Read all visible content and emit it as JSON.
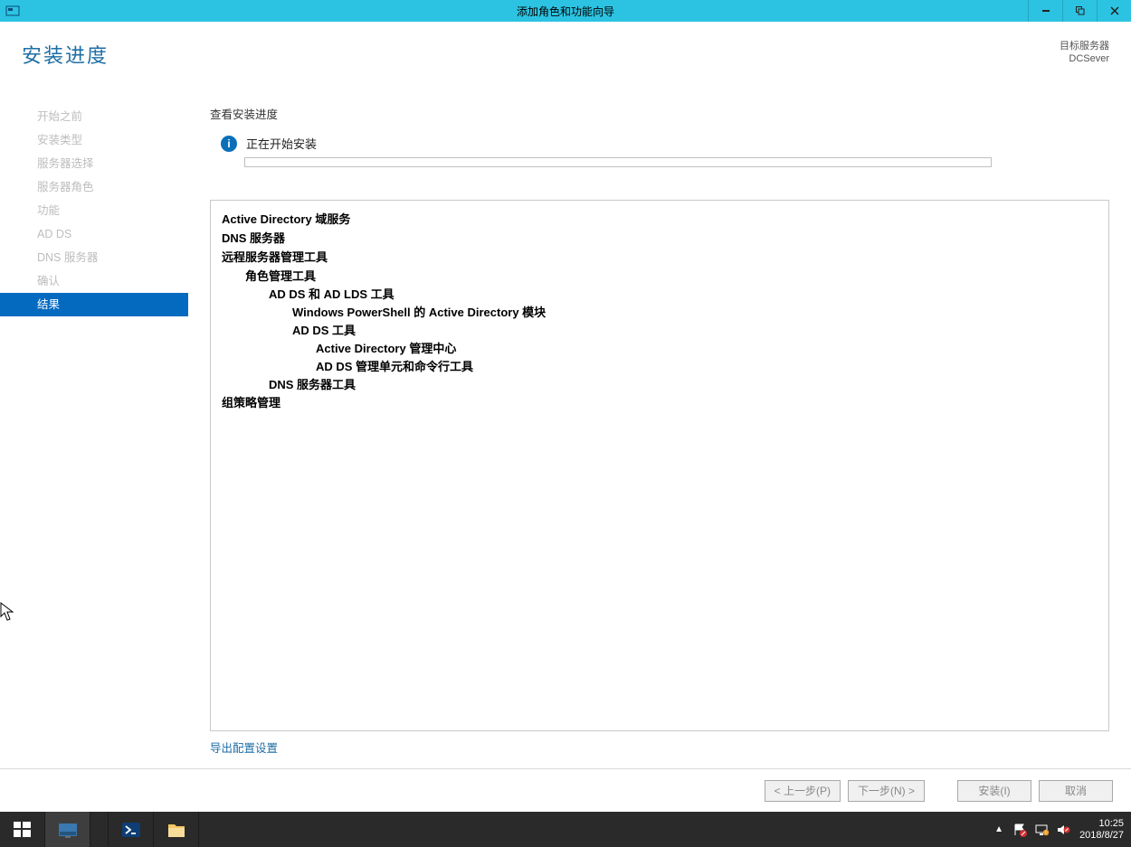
{
  "window": {
    "title": "添加角色和功能向导"
  },
  "header": {
    "title": "安装进度",
    "target_label": "目标服务器",
    "target_server": "DCSever"
  },
  "sidebar": {
    "steps": [
      "开始之前",
      "安装类型",
      "服务器选择",
      "服务器角色",
      "功能",
      "AD DS",
      "DNS 服务器",
      "确认",
      "结果"
    ],
    "active_index": 8
  },
  "content": {
    "section_label": "查看安装进度",
    "status_text": "正在开始安装",
    "results": {
      "ad_ds_domain_services": "Active Directory 域服务",
      "dns_server": "DNS 服务器",
      "remote_admin_tools": "远程服务器管理工具",
      "role_admin_tools": "角色管理工具",
      "adds_adlds_tools": "AD DS 和 AD LDS 工具",
      "ps_ad_module": "Windows PowerShell 的 Active Directory 模块",
      "adds_tools": "AD DS 工具",
      "ad_admin_center": "Active Directory 管理中心",
      "adds_snapins": "AD DS 管理单元和命令行工具",
      "dns_server_tools": "DNS 服务器工具",
      "group_policy_mgmt": "组策略管理"
    },
    "export_link": "导出配置设置"
  },
  "buttons": {
    "prev": "< 上一步(P)",
    "next": "下一步(N) >",
    "install": "安装(I)",
    "cancel": "取消"
  },
  "taskbar": {
    "time": "10:25",
    "date": "2018/8/27"
  }
}
